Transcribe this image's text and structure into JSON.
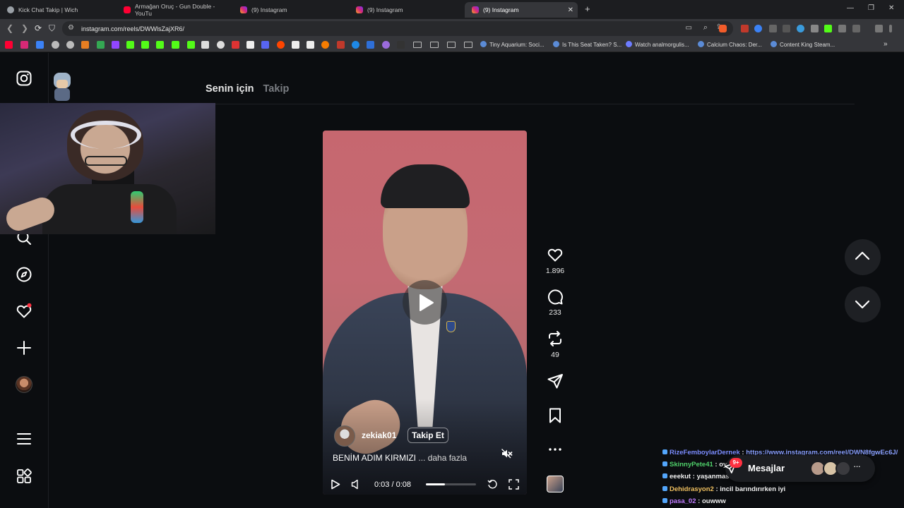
{
  "browser": {
    "tabs": [
      {
        "label": "Kick Chat Takip | Wich",
        "color": "#9aa0a6"
      },
      {
        "label": "Armağan Oruç - Gun Double - YouTu",
        "color": "#ff0033"
      },
      {
        "label": "(9) Instagram",
        "color": "#d62976"
      },
      {
        "label": "(9) Instagram",
        "color": "#d62976"
      },
      {
        "label": "(9) Instagram",
        "color": "#d62976"
      }
    ],
    "active_tab_index": 4,
    "url": "instagram.com/reels/DWWlsZajXR6/",
    "bookmarks": [
      {
        "label": "Tiny Aquarium: Soci..."
      },
      {
        "label": "Is This Seat Taken? S..."
      },
      {
        "label": "Watch analmorgulis..."
      },
      {
        "label": "Calcium Chaos: Der..."
      },
      {
        "label": "Content King Steam..."
      }
    ]
  },
  "feed": {
    "tab_for_you": "Senin için",
    "tab_following": "Takip"
  },
  "reel": {
    "username": "zekiak01",
    "follow_label": "Takip Et",
    "caption": "BENİM ADIM KIRMIZI",
    "more_label": "... daha fazla",
    "time_current": "0:03",
    "time_total": "0:08",
    "progress": 0.375
  },
  "actions": {
    "likes": "1.896",
    "comments": "233",
    "reposts": "49"
  },
  "chat": {
    "lines": [
      {
        "user": "RizeFemboylarDernek",
        "sep": " : ",
        "text": "https://www.instagram.com/reel/DWN8fgwEc6J/",
        "user_color": "#7b8cff",
        "text_color": "#8aa0ff"
      },
      {
        "user": "SkinnyPete41",
        "sep": " : ",
        "text": "oyna",
        "user_color": "#4fd06a",
        "text_color": "#f1f1f1"
      },
      {
        "user": "eeekut",
        "sep": " : ",
        "text": "yaşanması muhtemel",
        "user_color": "#f1f1f1",
        "text_color": "#f1f1f1"
      },
      {
        "user": "Dehidrasyon2",
        "sep": " : ",
        "text": "incil barındırırken iyi",
        "user_color": "#f0c060",
        "text_color": "#f1f1f1"
      },
      {
        "user": "pasa_02",
        "sep": " : ",
        "text": "ouwww",
        "user_color": "#c07cff",
        "text_color": "#f1f1f1"
      }
    ],
    "messages_label": "Mesajlar",
    "messages_badge": "9+"
  }
}
